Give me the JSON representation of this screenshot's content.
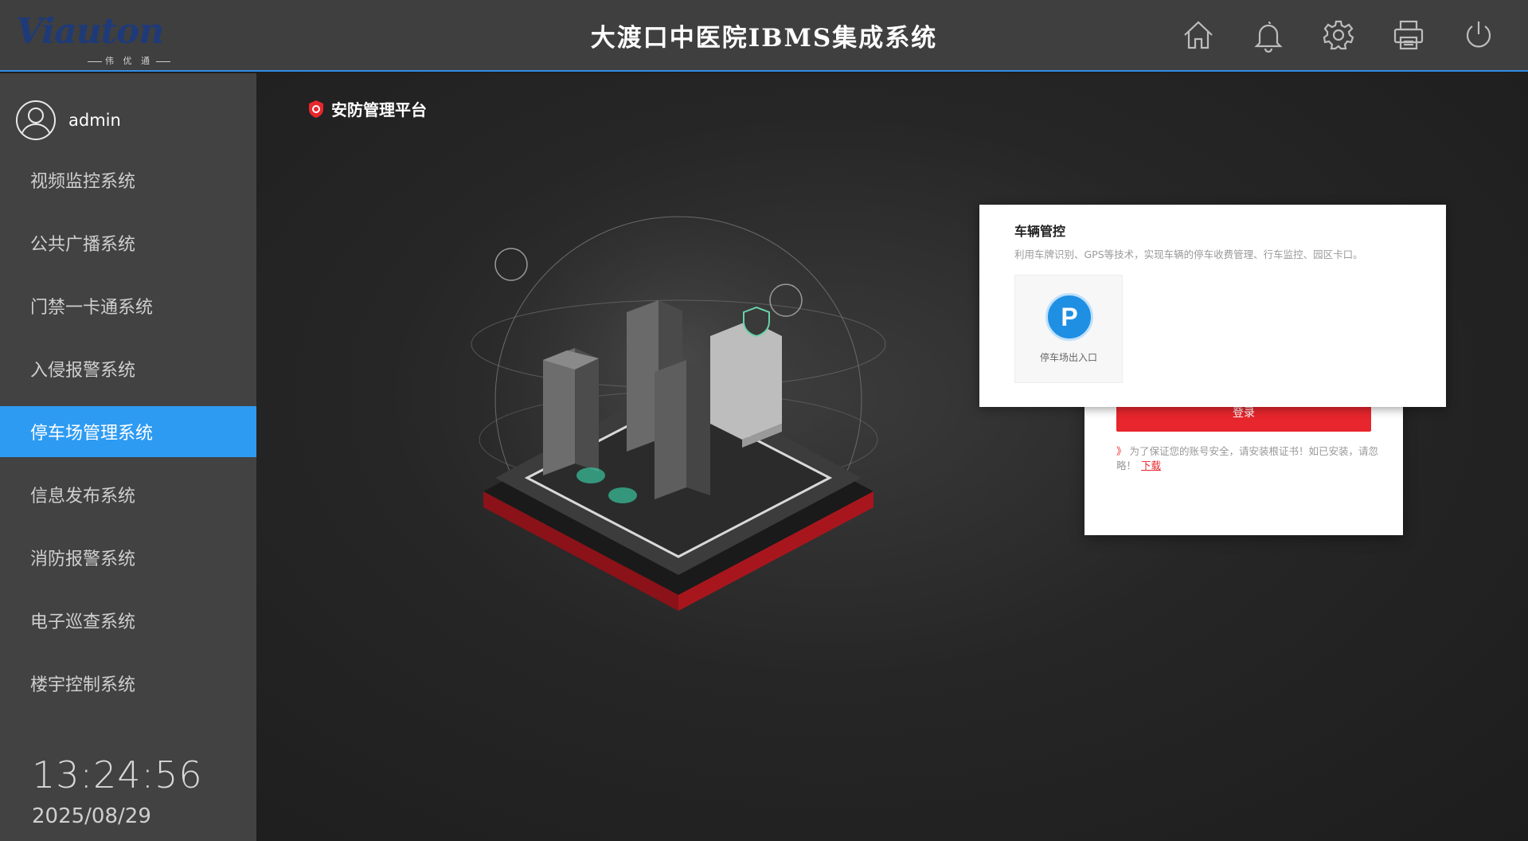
{
  "header": {
    "logo_text": "Viauton",
    "logo_sub": "伟 优 通",
    "title": "大渡口中医院IBMS集成系统",
    "icons": [
      "home-icon",
      "bell-icon",
      "gear-icon",
      "printer-icon",
      "power-icon"
    ]
  },
  "sidebar": {
    "username": "admin",
    "items": [
      {
        "label": "视频监控系统"
      },
      {
        "label": "公共广播系统"
      },
      {
        "label": "门禁一卡通系统"
      },
      {
        "label": "入侵报警系统"
      },
      {
        "label": "停车场管理系统",
        "active": true
      },
      {
        "label": "信息发布系统"
      },
      {
        "label": "消防报警系统"
      },
      {
        "label": "电子巡查系统"
      },
      {
        "label": "楼宇控制系统"
      }
    ],
    "time": "13:24:56",
    "date": "2025/08/29"
  },
  "main": {
    "platform_title": "安防管理平台",
    "login": {
      "button_label": "登录",
      "note_prefix": "》",
      "note_text": "为了保证您的账号安全，请安装根证书！如已安装，请忽略！",
      "download_label": "下载"
    },
    "vehicle_panel": {
      "title": "车辆管控",
      "description": "利用车牌识别、GPS等技术，实现车辆的停车收费管理、行车监控、园区卡口。",
      "tile_icon_text": "P",
      "tile_label": "停车场出入口"
    }
  },
  "colors": {
    "accent_blue": "#2e9bf2",
    "brand_red": "#e8262d",
    "header_bg": "#3f3f3f",
    "sidebar_bg": "#424242"
  }
}
